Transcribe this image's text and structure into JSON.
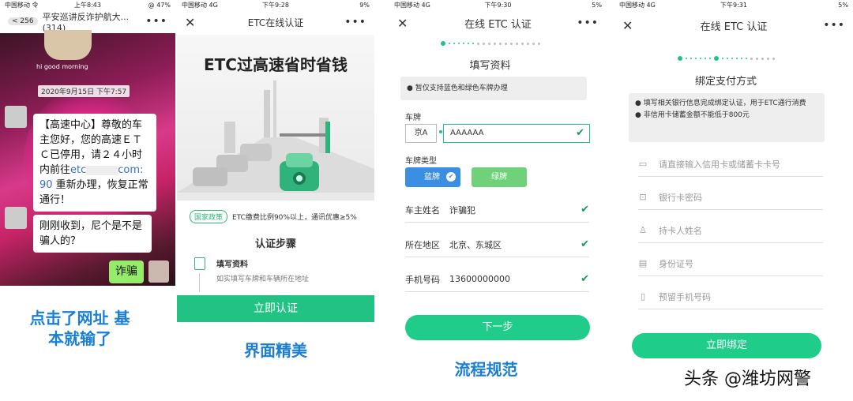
{
  "p1": {
    "status_left": "中国移动 令",
    "status_time": "上午8:43",
    "status_right": "@ 47%",
    "back": "< 256",
    "title": "平安巡讲反诈护航大... (314)",
    "date_stamp": "2020年9月15日 下午7:57",
    "sticker_text": "hi good morning",
    "msg1_a": "【高速中心】尊敬的车主您好，您的高速ＥＴＣ已停用，请２４小时内前往",
    "msg1_link_a": "etc",
    "msg1_link_b": "com:",
    "msg1_link_c": "90",
    "msg1_b": " 重新办理，恢复正常通行！",
    "msg2": "刚刚收到，尼个是不是骗人的？",
    "msg3": "诈骗",
    "caption": "点击了网址 基本就输了"
  },
  "p2": {
    "status_left": "中国移动 4G",
    "status_time": "下午9:28",
    "status_right": "9%",
    "title": "ETC在线认证",
    "banner": "ETC过高速省时省钱",
    "policy_tag": "国家政策",
    "policy_text": "ETC缴费比例90%以上，通讯优惠≥5%",
    "steps_title": "认证步骤",
    "step1_title": "填写资料",
    "step1_desc": "如实填写车牌和车辆所在地址",
    "button": "立即认证",
    "caption": "界面精美"
  },
  "p3": {
    "status_left": "中国移动 4G",
    "status_time": "下午9:30",
    "status_right": "5%",
    "title": "在线 ETC 认证",
    "section": "填写资料",
    "notice": "● 暂仅支持蓝色和绿色车牌办理",
    "plate_label": "车牌",
    "plate_prefix": "京A",
    "plate_value": "AAAAAA",
    "type_label": "车牌类型",
    "type_blue": "蓝牌",
    "type_green": "绿牌",
    "name_label": "车主姓名",
    "name_value": "诈骗犯",
    "region_label": "所在地区",
    "region_value": "北京、东城区",
    "phone_label": "手机号码",
    "phone_value": "13600000000",
    "button": "下一步",
    "caption": "流程规范"
  },
  "p4": {
    "status_left": "中国移动 4G",
    "status_time": "下午9:31",
    "status_right": "5%",
    "title": "在线 ETC 认证",
    "section": "绑定支付方式",
    "notice1": "● 填写相关银行信息完成绑定认证，用于ETC通行消费",
    "notice2": "● 非信用卡储蓄金额不能低于800元",
    "card_ph": "请直接输入信用卡或储蓄卡卡号",
    "pwd_ph": "银行卡密码",
    "holder_ph": "持卡人姓名",
    "id_ph": "身份证号",
    "phone_ph": "预留手机号码",
    "button": "立即绑定",
    "watermark": "头条 @潍坊网警"
  }
}
